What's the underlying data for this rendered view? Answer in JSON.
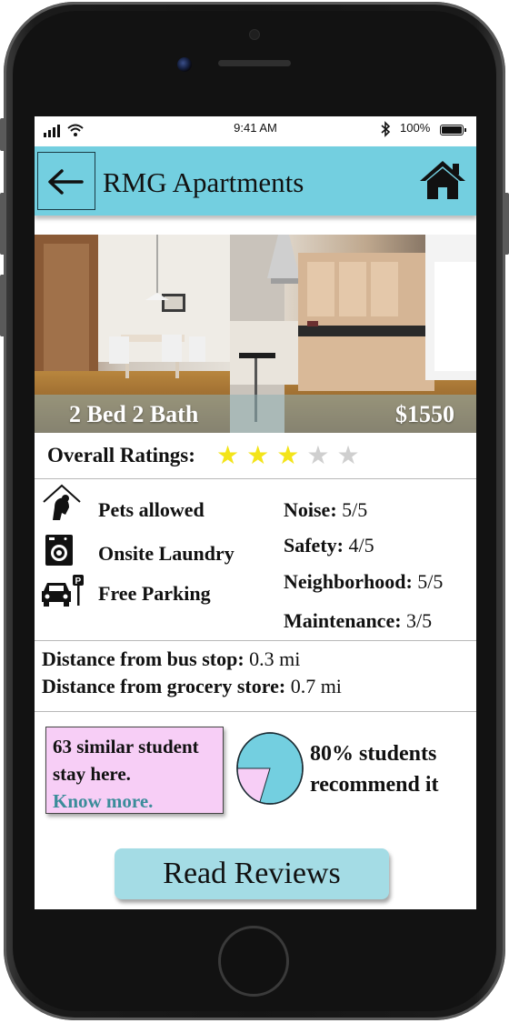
{
  "status_bar": {
    "time": "9:41 AM",
    "battery": "100%"
  },
  "header": {
    "title": "RMG Apartments"
  },
  "photo": {
    "beds_baths": "2 Bed 2 Bath",
    "price": "$1550"
  },
  "ratings": {
    "label": "Overall Ratings:",
    "stars_filled": 3,
    "stars_total": 5
  },
  "amenities": [
    {
      "label": "Pets allowed",
      "icon": "pet-icon"
    },
    {
      "label": "Onsite Laundry",
      "icon": "washing-machine-icon"
    },
    {
      "label": "Free Parking",
      "icon": "parking-car-icon"
    }
  ],
  "scores": [
    {
      "label": "Noise:",
      "value": "5/5"
    },
    {
      "label": "Safety:",
      "value": "4/5"
    },
    {
      "label": "Neighborhood:",
      "value": "5/5"
    },
    {
      "label": "Maintenance:",
      "value": "3/5"
    }
  ],
  "distances": [
    {
      "label": "Distance from bus stop:",
      "value": "0.3 mi"
    },
    {
      "label": "Distance from grocery store:",
      "value": "0.7 mi"
    }
  ],
  "similar": {
    "line1": "63 similar student",
    "line2": "stay here.",
    "link": "Know more."
  },
  "recommend": {
    "line1": "80% students",
    "line2": "recommend it",
    "percent": 80,
    "color_main": "#73cfe0",
    "color_rest": "#f7cef6"
  },
  "actions": {
    "read_reviews": "Read Reviews"
  }
}
